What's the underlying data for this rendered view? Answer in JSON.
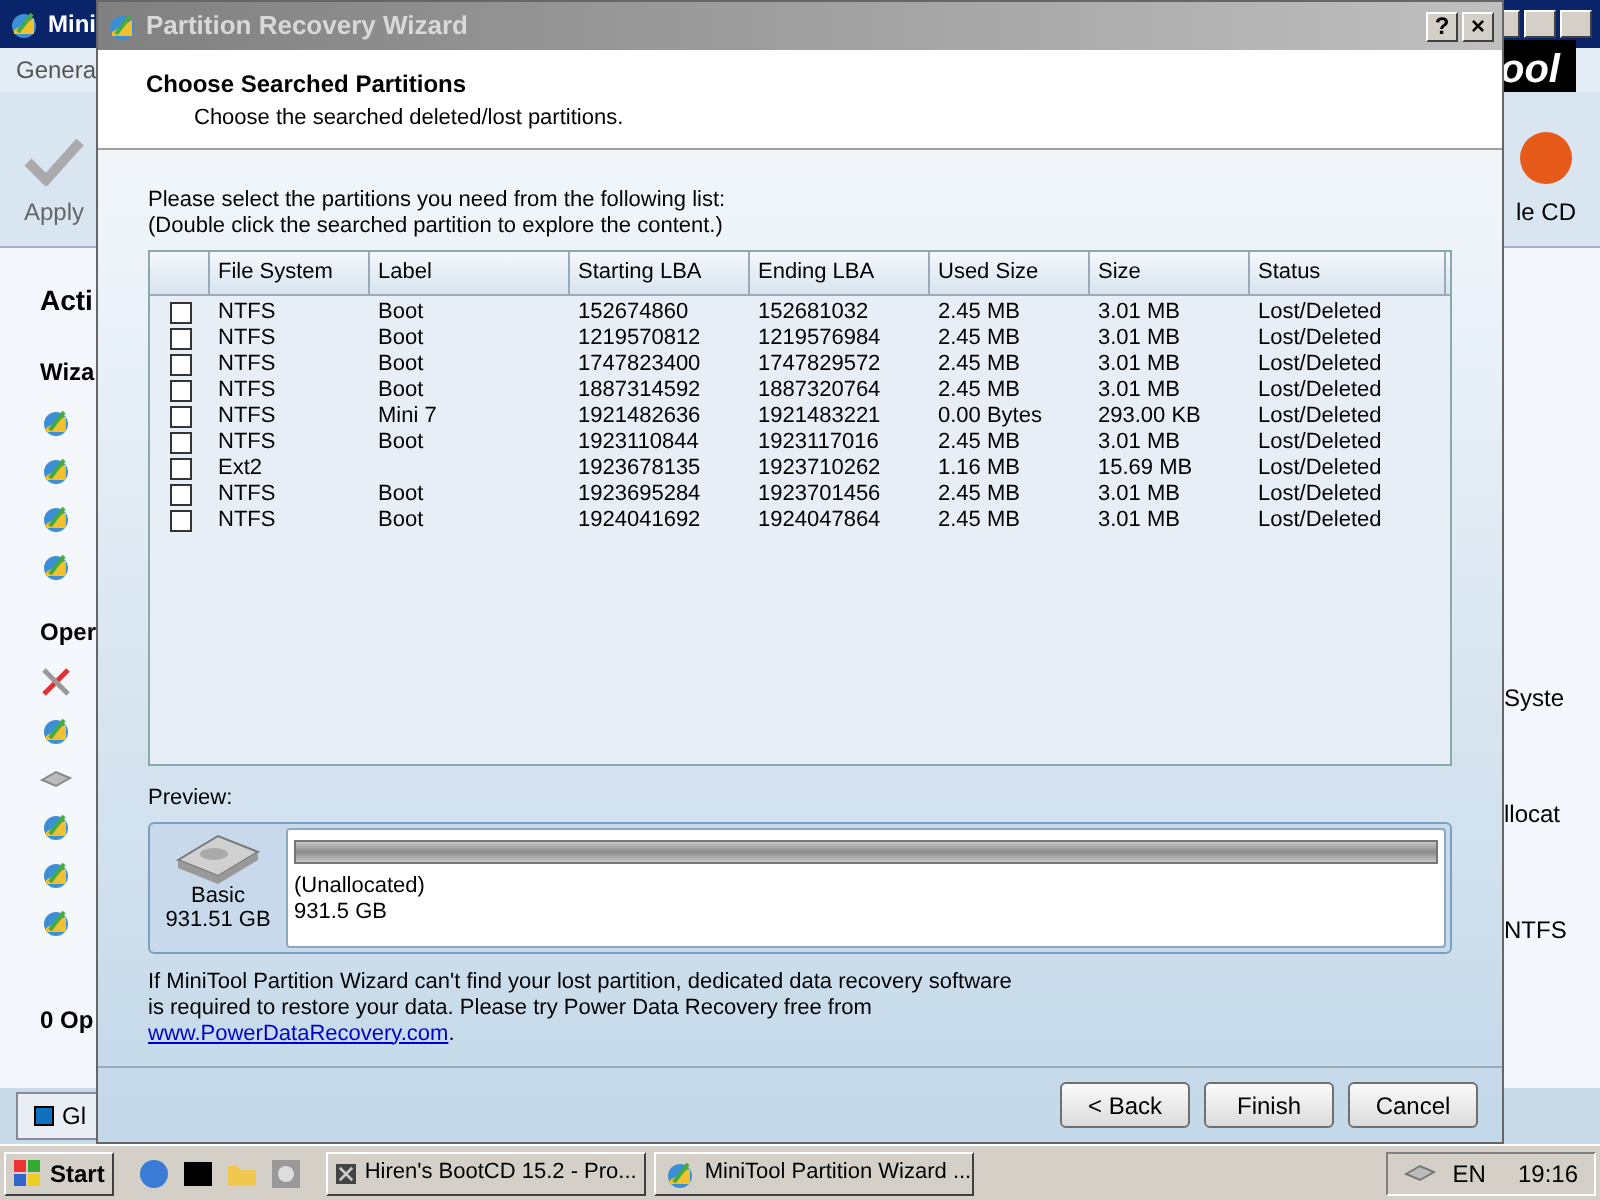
{
  "background_window": {
    "title": "Mini",
    "menu_item": "Genera",
    "toolbar": [
      {
        "label": "Apply"
      },
      {
        "label": "le CD"
      }
    ],
    "logo": "ool",
    "sidebar": {
      "heading": "Acti",
      "sections": [
        {
          "title": "Wiza",
          "icons": [
            {
              "kind": "wizard"
            },
            {
              "kind": "wizard"
            },
            {
              "kind": "wizard"
            },
            {
              "kind": "wizard"
            }
          ]
        },
        {
          "title": "Oper",
          "icons": [
            {
              "kind": "tools"
            },
            {
              "kind": "copy"
            },
            {
              "kind": "disk"
            },
            {
              "kind": "move"
            },
            {
              "kind": "delete"
            },
            {
              "kind": "format"
            }
          ]
        }
      ],
      "pending": "0 Op"
    },
    "legend": "Gl",
    "right_panel": {
      "column": "Syste",
      "cells": [
        "llocat",
        "NTFS"
      ]
    }
  },
  "dialog": {
    "title": "Partition Recovery Wizard",
    "header": {
      "title": "Choose Searched Partitions",
      "subtitle": "Choose the searched deleted/lost partitions."
    },
    "instructions": [
      "Please select the partitions you need from the following list:",
      "(Double click the searched partition to explore the content.)"
    ],
    "table": {
      "columns": [
        "File System",
        "Label",
        "Starting LBA",
        "Ending LBA",
        "Used Size",
        "Size",
        "Status"
      ],
      "rows": [
        {
          "checked": false,
          "cells": [
            "NTFS",
            "Boot",
            "152674860",
            "152681032",
            "2.45 MB",
            "3.01 MB",
            "Lost/Deleted"
          ]
        },
        {
          "checked": false,
          "cells": [
            "NTFS",
            "Boot",
            "1219570812",
            "1219576984",
            "2.45 MB",
            "3.01 MB",
            "Lost/Deleted"
          ]
        },
        {
          "checked": false,
          "cells": [
            "NTFS",
            "Boot",
            "1747823400",
            "1747829572",
            "2.45 MB",
            "3.01 MB",
            "Lost/Deleted"
          ]
        },
        {
          "checked": false,
          "cells": [
            "NTFS",
            "Boot",
            "1887314592",
            "1887320764",
            "2.45 MB",
            "3.01 MB",
            "Lost/Deleted"
          ]
        },
        {
          "checked": false,
          "cells": [
            "NTFS",
            "Mini 7",
            "1921482636",
            "1921483221",
            "0.00 Bytes",
            "293.00 KB",
            "Lost/Deleted"
          ]
        },
        {
          "checked": false,
          "cells": [
            "NTFS",
            "Boot",
            "1923110844",
            "1923117016",
            "2.45 MB",
            "3.01 MB",
            "Lost/Deleted"
          ]
        },
        {
          "checked": false,
          "cells": [
            "Ext2",
            "",
            "1923678135",
            "1923710262",
            "1.16 MB",
            "15.69 MB",
            "Lost/Deleted"
          ]
        },
        {
          "checked": false,
          "cells": [
            "NTFS",
            "Boot",
            "1923695284",
            "1923701456",
            "2.45 MB",
            "3.01 MB",
            "Lost/Deleted"
          ]
        },
        {
          "checked": false,
          "cells": [
            "NTFS",
            "Boot",
            "1924041692",
            "1924047864",
            "2.45 MB",
            "3.01 MB",
            "Lost/Deleted"
          ]
        }
      ]
    },
    "preview": {
      "label": "Preview:",
      "disk_type": "Basic",
      "disk_size": "931.51 GB",
      "partition": "(Unallocated)",
      "partition_size": "931.5 GB"
    },
    "note": [
      "If MiniTool Partition Wizard can't find your lost partition, dedicated data recovery software",
      "is required to restore your data. Please try Power Data Recovery free from"
    ],
    "link": "www.PowerDataRecovery.com",
    "link_suffix": ".",
    "buttons": [
      "< Back",
      "Finish",
      "Cancel"
    ],
    "title_buttons": [
      "?",
      "×"
    ]
  },
  "taskbar": {
    "start": "Start",
    "tasks": [
      "Hiren's BootCD 15.2 - Pro...",
      "MiniTool Partition Wizard ..."
    ],
    "language": "EN",
    "clock": "19:16"
  }
}
